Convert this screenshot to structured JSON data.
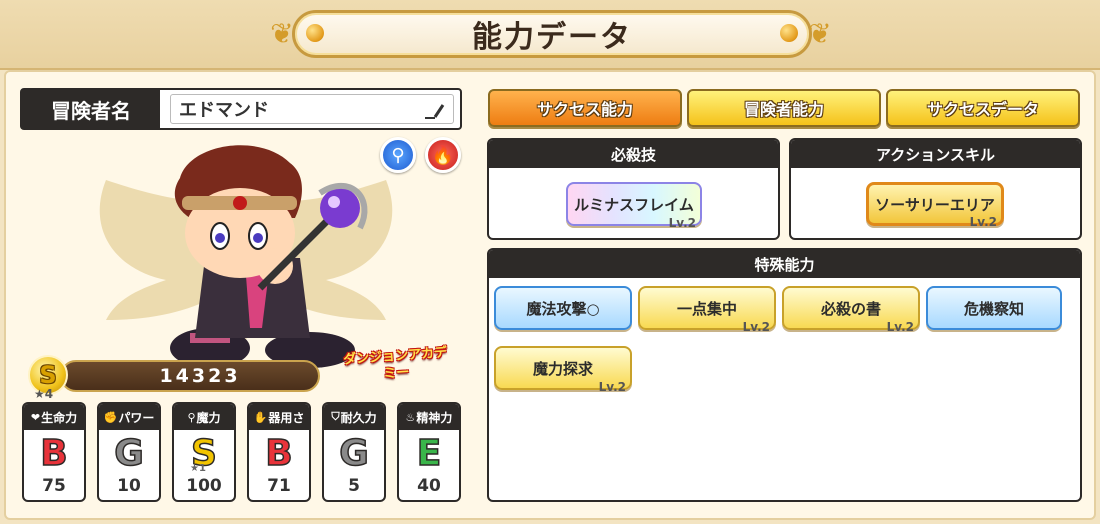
{
  "header": {
    "title": "能力データ"
  },
  "adventurer": {
    "name_label": "冒険者名",
    "name_value": "エドマンド"
  },
  "badges": {
    "academy_logo": "ダンジョンアカデミー"
  },
  "score": {
    "rank": "S",
    "stars": "★4",
    "value": "14323"
  },
  "stats": [
    {
      "icon": "heart-icon",
      "mini": "❤",
      "label": "生命力",
      "grade": "B",
      "grade_color": "#e8333a",
      "sub": "",
      "value": "75"
    },
    {
      "icon": "arm-icon",
      "mini": "💪",
      "label": "パワー",
      "grade": "G",
      "grade_color": "#8a8a8a",
      "sub": "",
      "value": "10"
    },
    {
      "icon": "magnifier-icon",
      "mini": "🔍",
      "label": "魔力",
      "grade": "S",
      "grade_color": "#f2c400",
      "sub": "★1",
      "value": "100"
    },
    {
      "icon": "hand-icon",
      "mini": "✋",
      "label": "器用さ",
      "grade": "B",
      "grade_color": "#e8333a",
      "sub": "",
      "value": "71"
    },
    {
      "icon": "shield-icon",
      "mini": "🛡",
      "label": "耐久力",
      "grade": "G",
      "grade_color": "#8a8a8a",
      "sub": "",
      "value": "5"
    },
    {
      "icon": "drop-icon",
      "mini": "💧",
      "label": "精神力",
      "grade": "E",
      "grade_color": "#3ab54a",
      "sub": "",
      "value": "40"
    }
  ],
  "tabs": [
    {
      "label": "サクセス能力",
      "active": true
    },
    {
      "label": "冒険者能力",
      "active": false
    },
    {
      "label": "サクセスデータ",
      "active": false
    }
  ],
  "special_move": {
    "title": "必殺技",
    "skill": {
      "name": "ルミナスフレイム",
      "level": "Lv.2"
    }
  },
  "action_skill": {
    "title": "アクションスキル",
    "skill": {
      "name": "ソーサリーエリア",
      "level": "Lv.2"
    }
  },
  "special_abilities": {
    "title": "特殊能力",
    "items": [
      {
        "name": "魔法攻撃○",
        "level": "",
        "style": "blue"
      },
      {
        "name": "一点集中",
        "level": "Lv.2",
        "style": "gold"
      },
      {
        "name": "必殺の書",
        "level": "Lv.2",
        "style": "gold"
      },
      {
        "name": "危機察知",
        "level": "",
        "style": "blue"
      },
      {
        "name": "魔力探求",
        "level": "Lv.2",
        "style": "gold"
      }
    ]
  },
  "colors": {
    "tab_active": "#ee7d12",
    "tab_inactive": "#f5c21a",
    "panel_dark": "#2d2a28",
    "background": "#f3e4c2"
  }
}
